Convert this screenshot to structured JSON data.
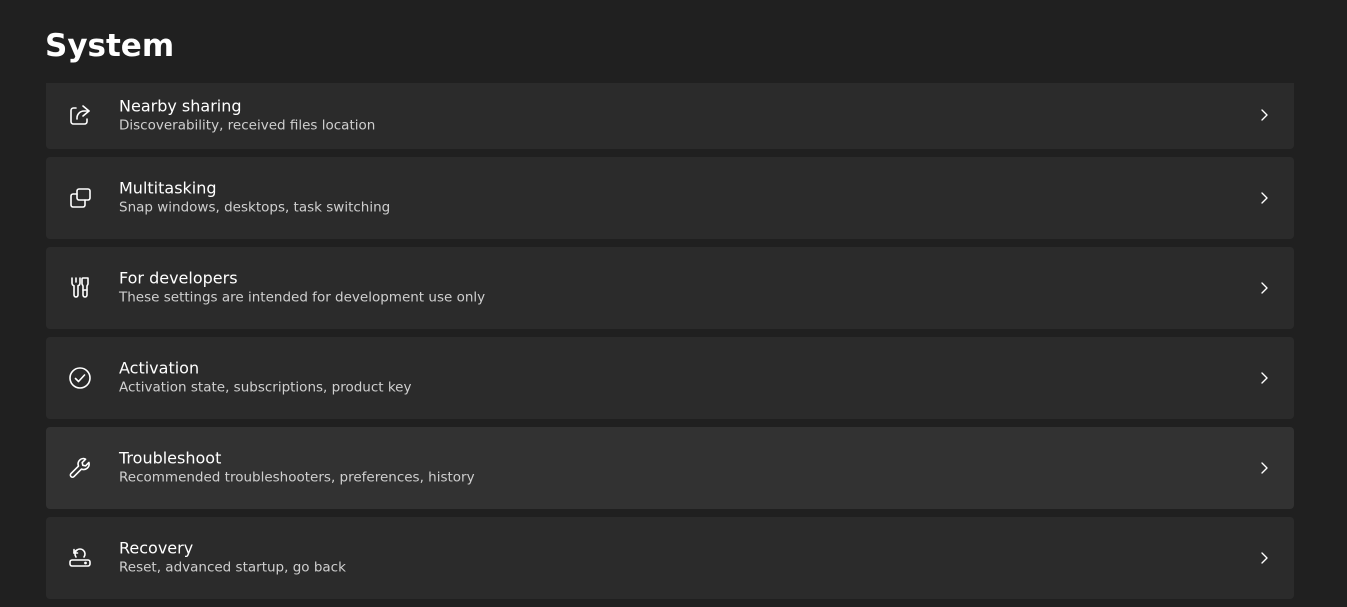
{
  "page": {
    "title": "System"
  },
  "items": [
    {
      "id": "nearby-sharing",
      "icon": "share-icon",
      "title": "Nearby sharing",
      "subtitle": "Discoverability, received files location"
    },
    {
      "id": "multitasking",
      "icon": "multitasking-icon",
      "title": "Multitasking",
      "subtitle": "Snap windows, desktops, task switching"
    },
    {
      "id": "for-developers",
      "icon": "developer-tools-icon",
      "title": "For developers",
      "subtitle": "These settings are intended for development use only"
    },
    {
      "id": "activation",
      "icon": "checkmark-circle-icon",
      "title": "Activation",
      "subtitle": "Activation state, subscriptions, product key"
    },
    {
      "id": "troubleshoot",
      "icon": "wrench-icon",
      "title": "Troubleshoot",
      "subtitle": "Recommended troubleshooters, preferences, history"
    },
    {
      "id": "recovery",
      "icon": "recovery-icon",
      "title": "Recovery",
      "subtitle": "Reset, advanced startup, go back"
    }
  ],
  "colors": {
    "background": "#202020",
    "card": "#2b2b2b",
    "card_hover": "#323232",
    "text_primary": "#ffffff",
    "text_secondary": "#cfcfcf"
  }
}
